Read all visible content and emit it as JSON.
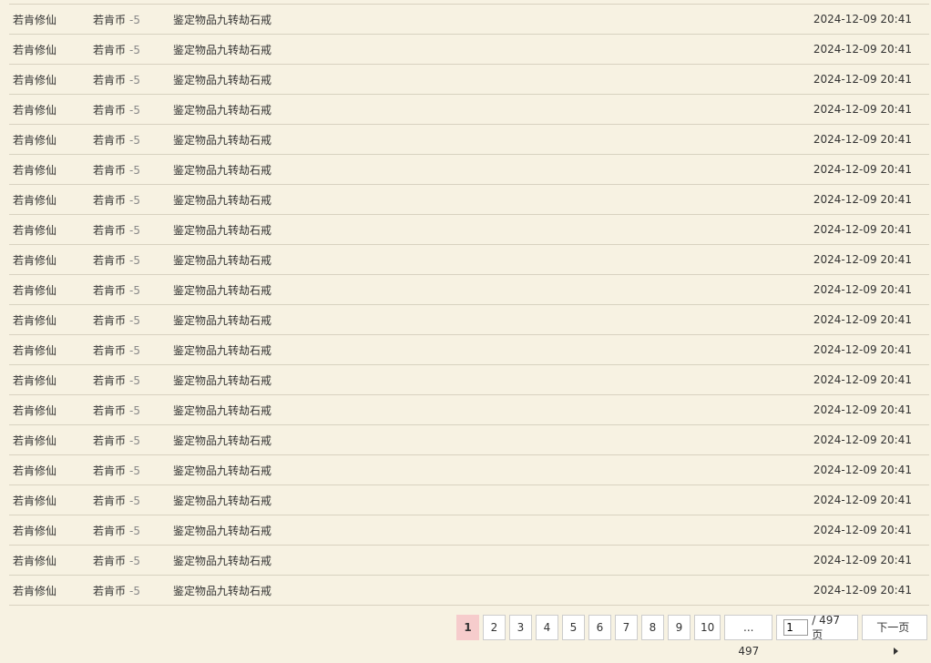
{
  "rows": [
    {
      "user": "若肯修仙",
      "currency": "若肯币",
      "amount": "-5",
      "description": "鉴定物品九转劫石戒",
      "time": "2024-12-09 20:41"
    },
    {
      "user": "若肯修仙",
      "currency": "若肯币",
      "amount": "-5",
      "description": "鉴定物品九转劫石戒",
      "time": "2024-12-09 20:41"
    },
    {
      "user": "若肯修仙",
      "currency": "若肯币",
      "amount": "-5",
      "description": "鉴定物品九转劫石戒",
      "time": "2024-12-09 20:41"
    },
    {
      "user": "若肯修仙",
      "currency": "若肯币",
      "amount": "-5",
      "description": "鉴定物品九转劫石戒",
      "time": "2024-12-09 20:41"
    },
    {
      "user": "若肯修仙",
      "currency": "若肯币",
      "amount": "-5",
      "description": "鉴定物品九转劫石戒",
      "time": "2024-12-09 20:41"
    },
    {
      "user": "若肯修仙",
      "currency": "若肯币",
      "amount": "-5",
      "description": "鉴定物品九转劫石戒",
      "time": "2024-12-09 20:41"
    },
    {
      "user": "若肯修仙",
      "currency": "若肯币",
      "amount": "-5",
      "description": "鉴定物品九转劫石戒",
      "time": "2024-12-09 20:41"
    },
    {
      "user": "若肯修仙",
      "currency": "若肯币",
      "amount": "-5",
      "description": "鉴定物品九转劫石戒",
      "time": "2024-12-09 20:41"
    },
    {
      "user": "若肯修仙",
      "currency": "若肯币",
      "amount": "-5",
      "description": "鉴定物品九转劫石戒",
      "time": "2024-12-09 20:41"
    },
    {
      "user": "若肯修仙",
      "currency": "若肯币",
      "amount": "-5",
      "description": "鉴定物品九转劫石戒",
      "time": "2024-12-09 20:41"
    },
    {
      "user": "若肯修仙",
      "currency": "若肯币",
      "amount": "-5",
      "description": "鉴定物品九转劫石戒",
      "time": "2024-12-09 20:41"
    },
    {
      "user": "若肯修仙",
      "currency": "若肯币",
      "amount": "-5",
      "description": "鉴定物品九转劫石戒",
      "time": "2024-12-09 20:41"
    },
    {
      "user": "若肯修仙",
      "currency": "若肯币",
      "amount": "-5",
      "description": "鉴定物品九转劫石戒",
      "time": "2024-12-09 20:41"
    },
    {
      "user": "若肯修仙",
      "currency": "若肯币",
      "amount": "-5",
      "description": "鉴定物品九转劫石戒",
      "time": "2024-12-09 20:41"
    },
    {
      "user": "若肯修仙",
      "currency": "若肯币",
      "amount": "-5",
      "description": "鉴定物品九转劫石戒",
      "time": "2024-12-09 20:41"
    },
    {
      "user": "若肯修仙",
      "currency": "若肯币",
      "amount": "-5",
      "description": "鉴定物品九转劫石戒",
      "time": "2024-12-09 20:41"
    },
    {
      "user": "若肯修仙",
      "currency": "若肯币",
      "amount": "-5",
      "description": "鉴定物品九转劫石戒",
      "time": "2024-12-09 20:41"
    },
    {
      "user": "若肯修仙",
      "currency": "若肯币",
      "amount": "-5",
      "description": "鉴定物品九转劫石戒",
      "time": "2024-12-09 20:41"
    },
    {
      "user": "若肯修仙",
      "currency": "若肯币",
      "amount": "-5",
      "description": "鉴定物品九转劫石戒",
      "time": "2024-12-09 20:41"
    },
    {
      "user": "若肯修仙",
      "currency": "若肯币",
      "amount": "-5",
      "description": "鉴定物品九转劫石戒",
      "time": "2024-12-09 20:41"
    }
  ],
  "pagination": {
    "current_page": "1",
    "pages": [
      "2",
      "3",
      "4",
      "5",
      "6",
      "7",
      "8",
      "9",
      "10"
    ],
    "last_page_label": "... 497",
    "jump_value": "1",
    "total_label": "/ 497 页",
    "next_label": "下一页"
  },
  "colors": {
    "background": "#f7f2e2",
    "current_page_bg": "#f6cccc",
    "row_border": "#d8d2c0"
  }
}
